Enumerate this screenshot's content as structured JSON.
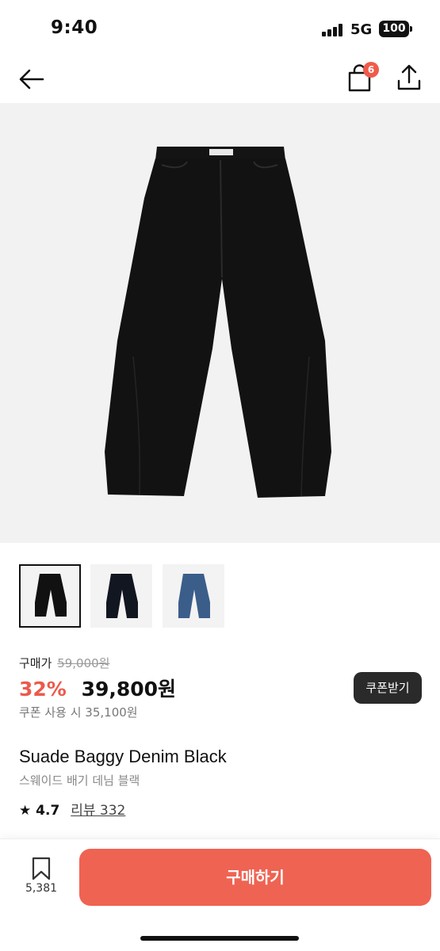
{
  "status_bar": {
    "time": "9:40",
    "network": "5G",
    "battery": "100"
  },
  "header": {
    "cart_count": "6",
    "icons": [
      "back-arrow-icon",
      "shopping-bag-icon",
      "share-icon"
    ]
  },
  "gallery": {
    "thumbnails": [
      {
        "color": "#111111",
        "selected": true
      },
      {
        "color": "#121620",
        "selected": false
      },
      {
        "color": "#3b5d8a",
        "selected": false
      }
    ]
  },
  "price": {
    "label": "구매가",
    "original": "59,000원",
    "discount": "32%",
    "sale": "39,800원",
    "coupon_text": "쿠폰 사용 시 35,100원",
    "coupon_button": "쿠폰받기"
  },
  "product": {
    "name": "Suade Baggy Denim Black",
    "name_kr": "스웨이드 배기 데님 블랙",
    "rating": "4.7",
    "reviews": "리뷰 332"
  },
  "bottom_bar": {
    "wish_count": "5,381",
    "buy_label": "구매하기"
  },
  "colors": {
    "accent": "#ef6352",
    "discount": "#ec5a4c"
  }
}
